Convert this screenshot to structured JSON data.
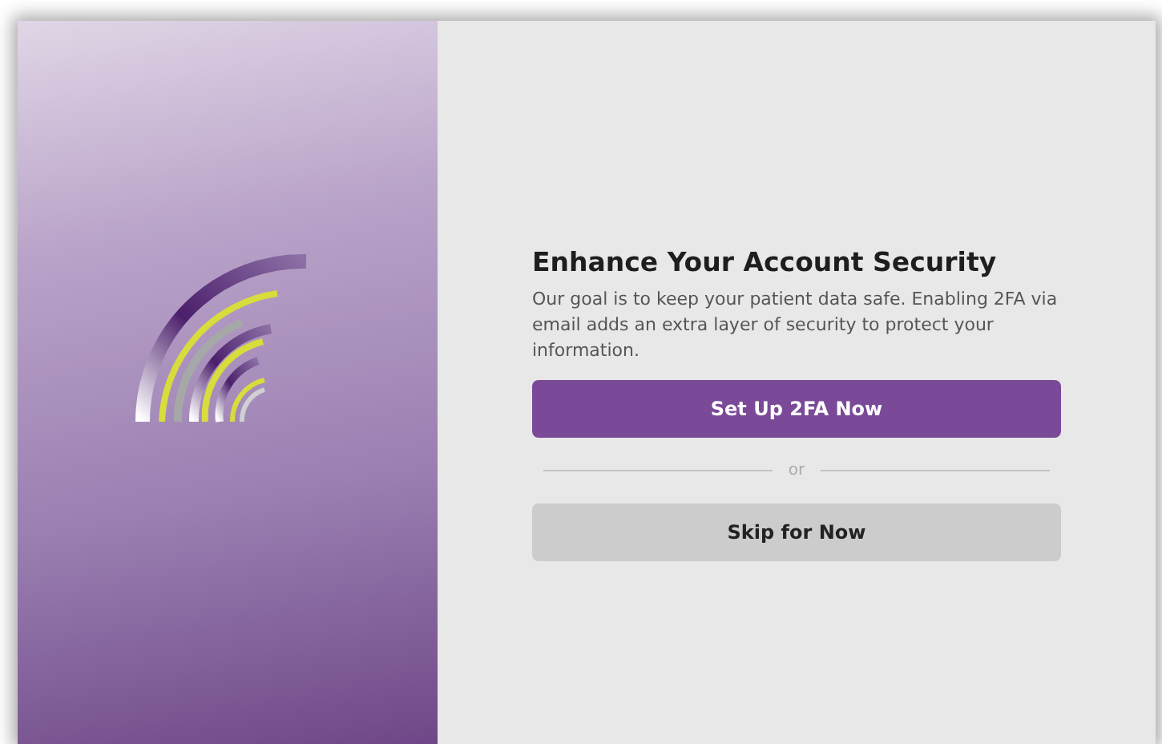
{
  "heading": "Enhance Your Account Security",
  "description": "Our goal is to keep your patient data safe. Enabling 2FA via email adds an extra layer of security to protect your information.",
  "primary_button": "Set Up 2FA Now",
  "divider_text": "or",
  "secondary_button": "Skip for Now"
}
